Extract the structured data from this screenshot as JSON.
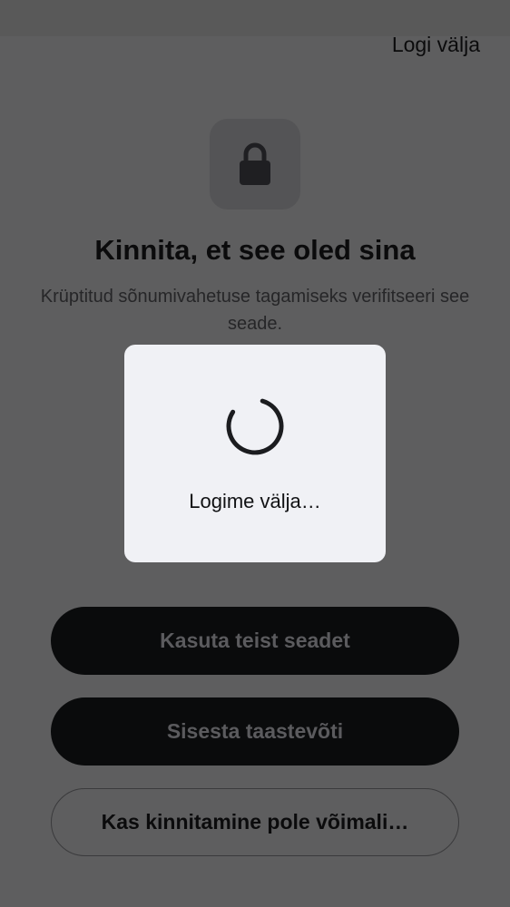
{
  "header": {
    "logout_label": "Logi välja"
  },
  "verification": {
    "icon": "lock-icon",
    "title": "Kinnita, et see oled sina",
    "subtitle": "Krüptitud sõnumivahetuse tagamiseks verifitseeri see seade."
  },
  "actions": {
    "use_other_device_label": "Kasuta teist seadet",
    "enter_recovery_key_label": "Sisesta taastevõti",
    "cannot_verify_label": "Kas kinnitamine pole võimali…"
  },
  "progress_dialog": {
    "icon": "spinner-icon",
    "message": "Logime välja…"
  },
  "colors": {
    "scrim_background": "#5e5e5f",
    "dialog_background": "#f0f1f5",
    "primary_button": "#0a0b0c",
    "text_primary": "#0b0b0c"
  }
}
